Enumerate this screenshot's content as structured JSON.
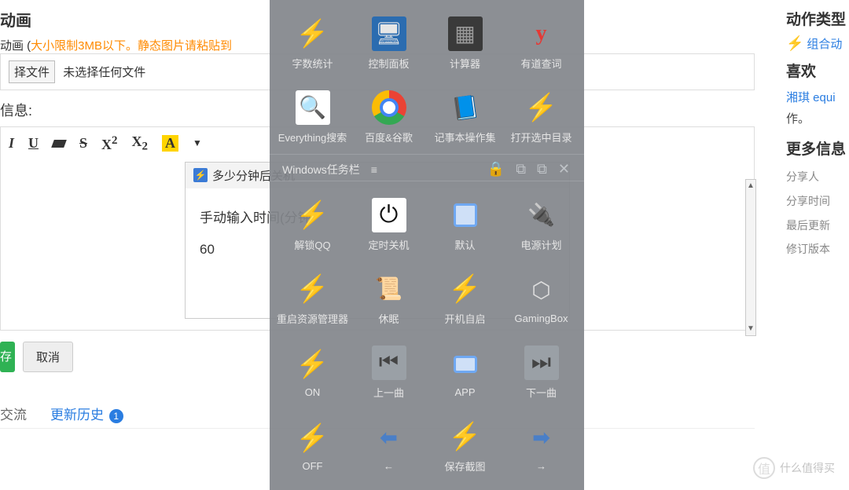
{
  "left": {
    "heading_anim": "动画",
    "anim_text": "动画 (",
    "anim_hint": "大小限制3MB以下。静态图片请粘贴到",
    "choose_file": "择文件",
    "no_file": "未选择任何文件",
    "info_label": "信息:",
    "toolbar": {
      "italic": "I",
      "underline": "U",
      "strike": "S",
      "sup": "X",
      "sub": "X",
      "hl": "A"
    },
    "inner": {
      "title": "多少分钟后关机",
      "line1": "手动输入时间(分钟",
      "line2": "60"
    },
    "save": "存",
    "cancel": "取消",
    "tabs": {
      "t1": "交流",
      "t2": "更新历史",
      "badge": "1"
    }
  },
  "right": {
    "h1": "动作类型",
    "item1": "组合动",
    "h2": "喜欢",
    "like_text": "湘琪 equi",
    "like_text2": "作。",
    "h3": "更多信息",
    "more": [
      "分享人",
      "分享时间",
      "最后更新",
      "修订版本"
    ]
  },
  "overlay": {
    "row1": [
      "字数统计",
      "控制面板",
      "计算器",
      "有道查词"
    ],
    "row2": [
      "Everything搜索",
      "百度&谷歌",
      "记事本操作集",
      "打开选中目录"
    ],
    "sep": "Windows任务栏",
    "row3": [
      "解锁QQ",
      "定时关机",
      "默认",
      "电源计划"
    ],
    "row4": [
      "重启资源管理器",
      "休眠",
      "开机自启",
      "GamingBox"
    ],
    "row5": [
      "ON",
      "上一曲",
      "APP",
      "下一曲"
    ],
    "row6": [
      "OFF",
      "←",
      "保存截图",
      "→"
    ]
  },
  "watermark": "什么值得买"
}
